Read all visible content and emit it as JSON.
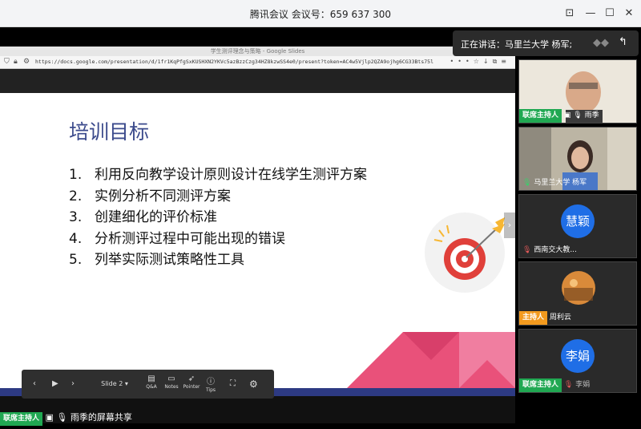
{
  "meeting": {
    "title": "腾讯会议 会议号：659 637 300",
    "speaking": "正在讲话：马里兰大学 杨军;",
    "share_label": "雨季的屏幕共享"
  },
  "browser": {
    "tab_title": "学生测评理念与策略 - Google Slides",
    "url": "https://docs.google.com/presentation/d/1fr1KqPfgSxKUSHXN2YKVc5azBzzCzg34HZ8kzwSS4e0/present?token=AC4w5Vjlp2QZA9ojhg6CG33Bts75l"
  },
  "slide": {
    "title": "培训目标",
    "items": [
      {
        "num": "1.",
        "text": "利用反向教学设计原则设计在线学生测评方案"
      },
      {
        "num": "2.",
        "text": "实例分析不同测评方案"
      },
      {
        "num": "3.",
        "text": "创建细化的评价标准"
      },
      {
        "num": "4.",
        "text": "分析测评过程中可能出现的错误"
      },
      {
        "num": "5.",
        "text": "列举实际测试策略性工具"
      }
    ]
  },
  "slides_toolbar": {
    "current_slide": "Slide 2",
    "qa": "Q&A",
    "notes": "Notes",
    "pointer": "Pointer",
    "tips": "Tips"
  },
  "participants": [
    {
      "name": "雨季",
      "tag": "联席主持人"
    },
    {
      "name": "马里兰大学 杨军"
    },
    {
      "name": "西南交大教...",
      "avatar": "慧颖"
    },
    {
      "name": "周利云",
      "tag": "主持人"
    },
    {
      "name": "李娟",
      "tag": "联席主持人",
      "avatar": "李娟"
    }
  ],
  "colors": {
    "cohost_tag": "#20a852",
    "host_tag": "#f39a1e",
    "avatar_blue": "#1f6ee6",
    "slide_title": "#3b4a8c"
  }
}
